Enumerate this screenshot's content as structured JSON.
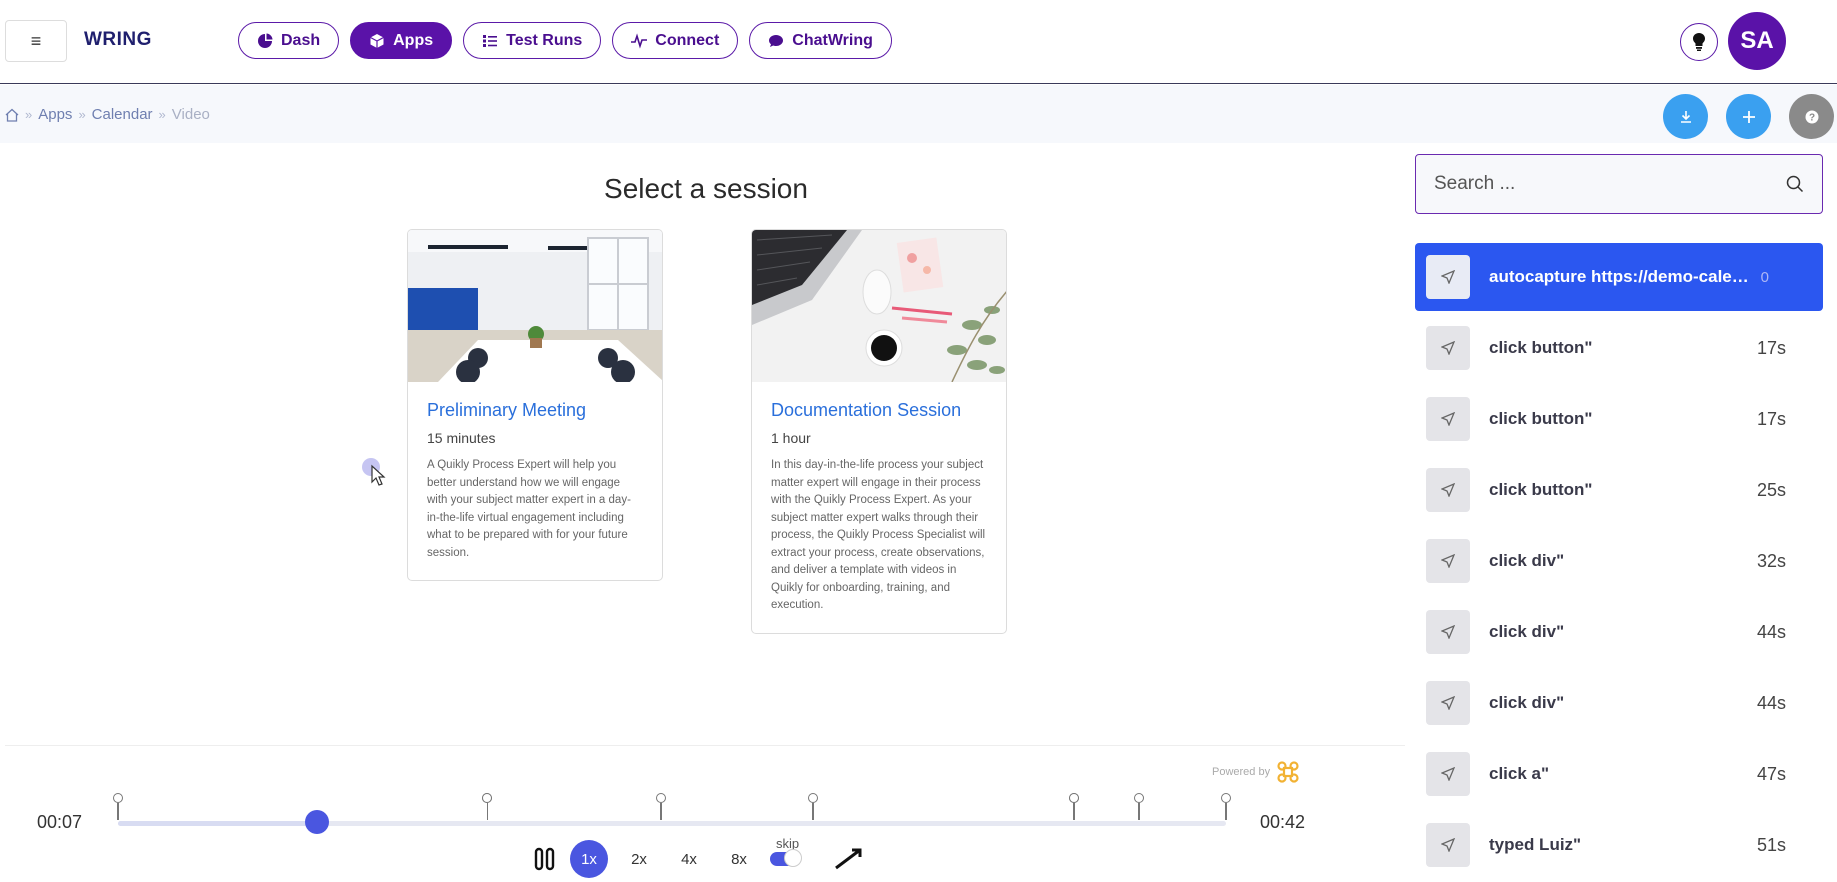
{
  "header": {
    "menu_icon": "hamburger-icon",
    "brand": "WRING",
    "nav": [
      {
        "label": "Dash",
        "icon": "pie-chart-icon",
        "active": false
      },
      {
        "label": "Apps",
        "icon": "cube-icon",
        "active": true
      },
      {
        "label": "Test Runs",
        "icon": "list-icon",
        "active": false
      },
      {
        "label": "Connect",
        "icon": "pulse-icon",
        "active": false
      },
      {
        "label": "ChatWring",
        "icon": "chat-bubble-icon",
        "active": false
      }
    ],
    "avatar_initials": "SA"
  },
  "breadcrumb": {
    "home_icon": "home-icon",
    "items": [
      "Apps",
      "Calendar",
      "Video"
    ]
  },
  "actions": {
    "download_color": "#3aa0f0",
    "add_color": "#3aa0f0",
    "help_color": "#8a8a8a"
  },
  "main": {
    "title": "Select a session",
    "cards": [
      {
        "title": "Preliminary Meeting",
        "duration": "15 minutes",
        "description": "A Quikly Process Expert will help you better understand how we will engage with your subject matter expert in a day-in-the-life virtual engagement including what to be prepared with for your future session."
      },
      {
        "title": "Documentation Session",
        "duration": "1 hour",
        "description": "In this day-in-the-life process your subject matter expert will engage in their process with the Quikly Process Expert. As your subject matter expert walks through their process, the Quikly Process Specialist will extract your process, create observations, and deliver a template with videos in Quikly for onboarding, training, and execution."
      }
    ],
    "powered_by": "Powered by"
  },
  "player": {
    "current_time": "00:07",
    "total_time": "00:42",
    "progress_fraction": 0.18,
    "speeds": [
      "1x",
      "2x",
      "4x",
      "8x"
    ],
    "active_speed": "1x",
    "skip_label": "skip",
    "skip_enabled": true
  },
  "sidebar": {
    "search_placeholder": "Search ...",
    "events": [
      {
        "label": "autocapture https://demo-calendar.wring.dev/video",
        "time": "0",
        "active": true
      },
      {
        "label": "click button\"",
        "time": "17s",
        "active": false
      },
      {
        "label": "click button\"",
        "time": "17s",
        "active": false
      },
      {
        "label": "click button\"",
        "time": "25s",
        "active": false
      },
      {
        "label": "click div\"",
        "time": "32s",
        "active": false
      },
      {
        "label": "click div\"",
        "time": "44s",
        "active": false
      },
      {
        "label": "click div\"",
        "time": "44s",
        "active": false
      },
      {
        "label": "click a\"",
        "time": "47s",
        "active": false
      },
      {
        "label": "typed Luiz\"",
        "time": "51s",
        "active": false
      }
    ]
  }
}
